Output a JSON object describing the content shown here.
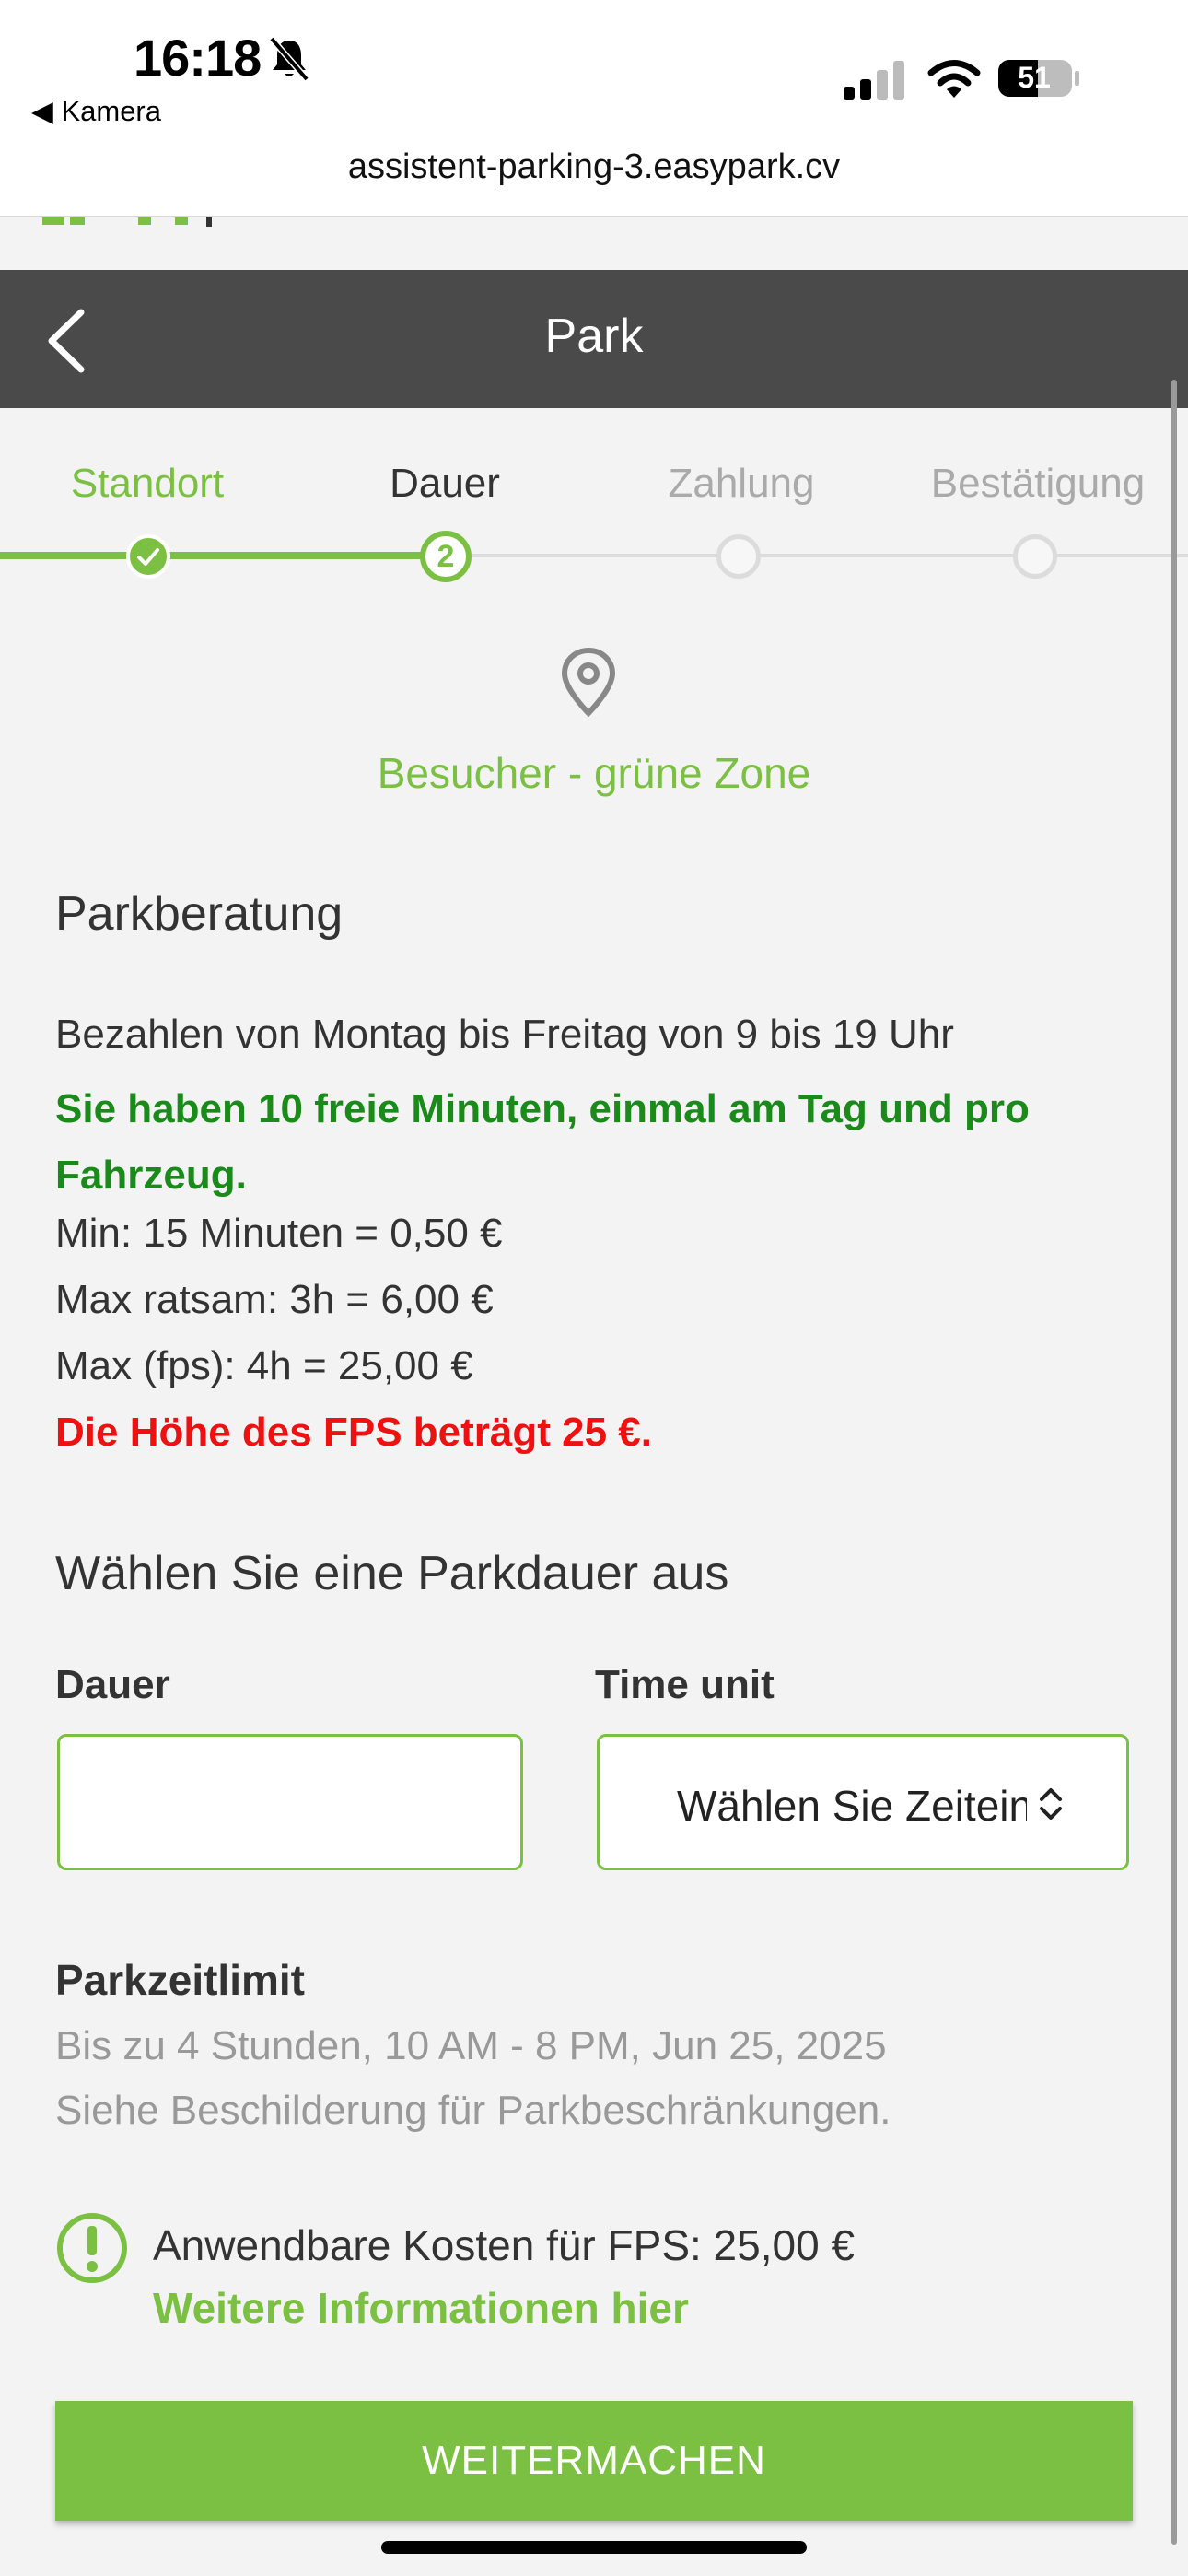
{
  "status_bar": {
    "time": "16:18",
    "back_app": "Kamera",
    "battery": "51",
    "url": "assistent-parking-3.easypark.cv"
  },
  "navbar": {
    "title": "Park"
  },
  "steps": [
    {
      "label": "Standort",
      "state": "done"
    },
    {
      "label": "Dauer",
      "state": "current",
      "number": "2"
    },
    {
      "label": "Zahlung",
      "state": "todo"
    },
    {
      "label": "Bestätigung",
      "state": "todo"
    }
  ],
  "zone": {
    "name": "Besucher - grüne Zone",
    "icon": "location-pin-icon"
  },
  "advice": {
    "heading": "Parkberatung",
    "lines": [
      "Bezahlen von Montag bis Freitag von 9 bis 19 Uhr",
      "Sie haben 10 freie Minuten, einmal am Tag und pro Fahrzeug.",
      "Min: 15 Minuten = 0,50 €",
      "Max ratsam: 3h = 6,00 €",
      "Max (fps): 4h = 25,00 €",
      "Die Höhe des FPS beträgt 25 €."
    ]
  },
  "duration": {
    "heading": "Wählen Sie eine Parkdauer aus",
    "dauer_label": "Dauer",
    "dauer_value": "",
    "unit_label": "Time unit",
    "unit_placeholder": "Wählen Sie Zeiteinheit"
  },
  "limit": {
    "heading": "Parkzeitlimit",
    "line1": "Bis zu 4 Stunden, 10 AM - 8 PM, Jun 25, 2025",
    "line2": "Siehe Beschilderung für Parkbeschränkungen."
  },
  "fps": {
    "cost": "Anwendbare Kosten für FPS: 25,00 €",
    "link": "Weitere Informationen hier"
  },
  "continue_label": "WEITERMACHEN",
  "colors": {
    "accent": "#7bc043",
    "navbar": "#4a4a4a",
    "free_text": "#1a8a1a",
    "warning": "#ee1111"
  }
}
